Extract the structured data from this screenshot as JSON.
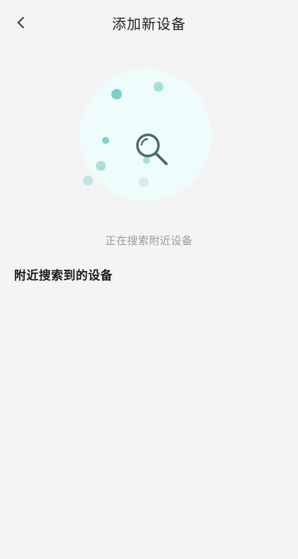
{
  "header": {
    "title": "添加新设备",
    "back_icon": "chevron-left-icon"
  },
  "scan": {
    "status_text": "正在搜索附近设备",
    "icon": "search-icon",
    "colors": {
      "circle": "#eefdfb",
      "dot_strong": "#7fcfca",
      "dot_light": "#b6e6e2",
      "glass": "#4a6b6b"
    }
  },
  "devices": {
    "section_title": "附近搜索到的设备",
    "items": []
  }
}
